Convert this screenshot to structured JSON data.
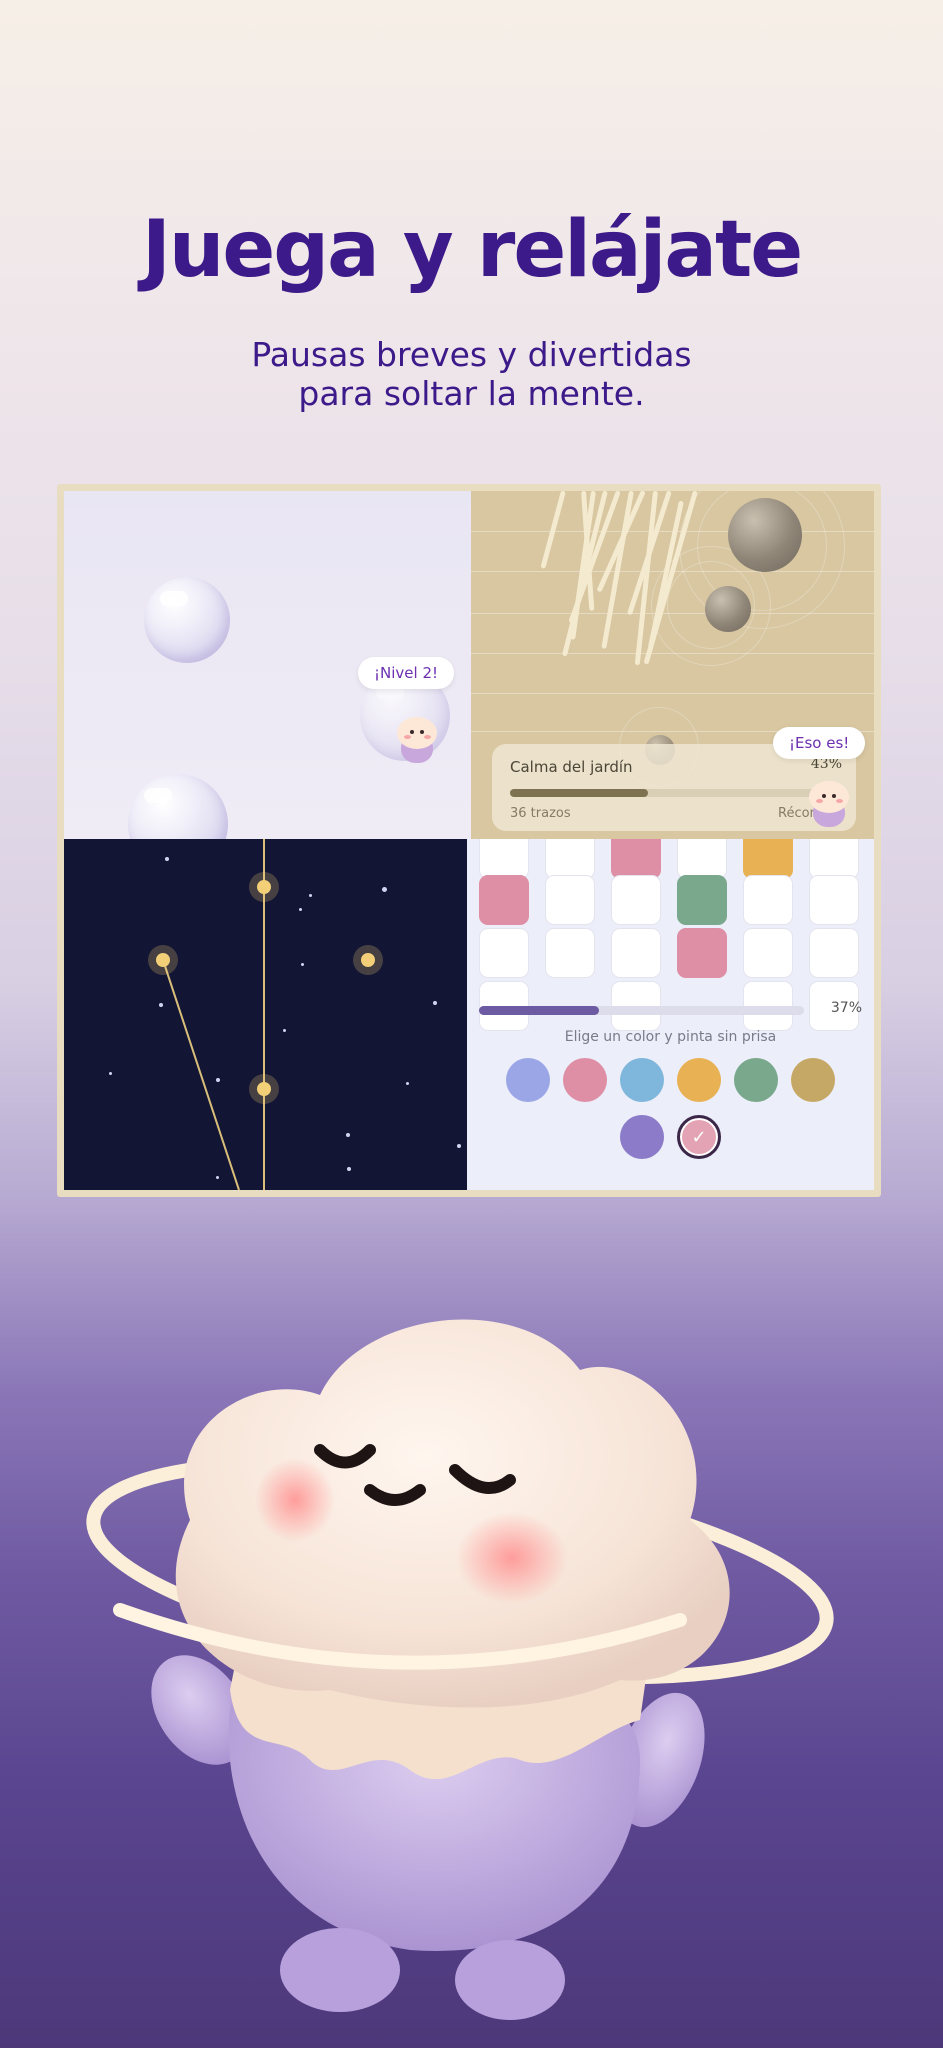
{
  "hero": {
    "title": "Juega y relájate",
    "subtitle_line1": "Pausas breves y divertidas",
    "subtitle_line2": "para soltar la mente."
  },
  "games": {
    "bubbles": {
      "speech": "¡Nivel 2!"
    },
    "zen_garden": {
      "speech": "¡Eso es!",
      "card_label": "Calma del jardín",
      "percent_label": "43%",
      "progress": 0.43,
      "strokes_label": "36 trazos",
      "record_label": "Récor"
    },
    "constellation": {},
    "coloring": {
      "progress": 0.37,
      "percent_label": "37%",
      "hint": "Elige un color y pinta sin prisa",
      "palette": [
        "#9aa6e6",
        "#de8fa6",
        "#7fb7dc",
        "#e8b153",
        "#7aa88c",
        "#c5a865",
        "#8c7bc8",
        "#e3a3b4"
      ],
      "selected_color_index": 7,
      "check_icon": "check-icon"
    }
  },
  "colors": {
    "title": "#3d1a8a",
    "accent": "#6b2fb0"
  }
}
